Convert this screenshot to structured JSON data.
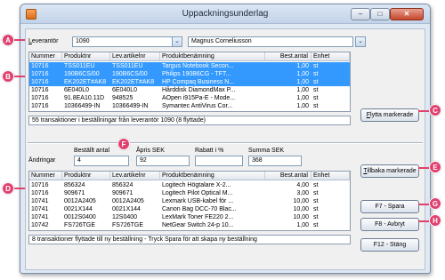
{
  "window": {
    "title": "Uppackningsunderlag",
    "min": "–",
    "max": "□",
    "close": "✕"
  },
  "supplier": {
    "label": "Leverantör",
    "code": "1090",
    "name": "Magnus Corneliusson",
    "dd": "⌄"
  },
  "top_grid": {
    "headers": [
      "Nummer",
      "Produktnr",
      "Lev.artikelnr",
      "Produktbenämning",
      "Best.antal",
      "Enhet"
    ],
    "rows": [
      {
        "nr": "10716",
        "prod": "TSS011EU",
        "lev": "TSS011EU",
        "name": "Targus Notebook Secon...",
        "qty": "1,00",
        "unit": "st",
        "selected": true
      },
      {
        "nr": "10716",
        "prod": "190B6CS/00",
        "lev": "190B6CS/00",
        "name": "Philips 190B6CG - TFT...",
        "qty": "1,00",
        "unit": "st",
        "selected": true
      },
      {
        "nr": "10716",
        "prod": "EK202ET#AK8",
        "lev": "EK202ET#AK8",
        "name": "HP Compaq Business N...",
        "qty": "1,00",
        "unit": "st",
        "selected": true
      },
      {
        "nr": "10716",
        "prod": "6E040L0",
        "lev": "6E040L0",
        "name": "Hårddisk DiamondMax P...",
        "qty": "1,00",
        "unit": "st",
        "selected": false
      },
      {
        "nr": "10716",
        "prod": "91.8EA10.11D",
        "lev": "948525",
        "name": "AOpen i915Pa-E - Mode...",
        "qty": "1,00",
        "unit": "st",
        "selected": false
      },
      {
        "nr": "10716",
        "prod": "10366499-IN",
        "lev": "10366499-IN",
        "name": "Symantec AntiVirus Cor...",
        "qty": "1,00",
        "unit": "st",
        "selected": false
      }
    ],
    "status": "55 transaktioner i beställningar från leverantör 1090 (8 flyttade)"
  },
  "move_btn": {
    "pre": "",
    "u": "F",
    "post": "lytta markerade"
  },
  "edit": {
    "row_label": "Ändringar",
    "qty_label": "Beställt antal",
    "qty": "4",
    "price_label": "Åpris SEK",
    "price": "92",
    "disc_label": "Rabatt i %",
    "disc": "",
    "sum_label": "Summa SEK",
    "sum": "368"
  },
  "back_btn": {
    "u": "T",
    "post": "illbaka markerade"
  },
  "bottom_grid": {
    "headers": [
      "Nummer",
      "Produktnr",
      "Lev.artikelnr",
      "Produktbenämning",
      "Best.antal",
      "Enhet"
    ],
    "rows": [
      {
        "nr": "10716",
        "prod": "856324",
        "lev": "856324",
        "name": "Logitech Högtalare X-2...",
        "qty": "4,00",
        "unit": "st"
      },
      {
        "nr": "10716",
        "prod": "909671",
        "lev": "909671",
        "name": "Logitech Pilot Optical M...",
        "qty": "3,00",
        "unit": "st"
      },
      {
        "nr": "10741",
        "prod": "0012A2405",
        "lev": "0012A2405",
        "name": "Lexmark USB-kabel för ...",
        "qty": "10,00",
        "unit": "st"
      },
      {
        "nr": "10741",
        "prod": "0021X144",
        "lev": "0021X144",
        "name": "Canon Bag DCC-70 Blac...",
        "qty": "10,00",
        "unit": "st"
      },
      {
        "nr": "10741",
        "prod": "0012S0400",
        "lev": "12S0400",
        "name": "LexMark Toner FE220 2...",
        "qty": "10,00",
        "unit": "st"
      },
      {
        "nr": "10742",
        "prod": "FS726TGE",
        "lev": "FS726TGE",
        "name": "NetGear Switch 24-p 10...",
        "qty": "1,00",
        "unit": "st"
      }
    ],
    "status": "8 transaktioner flyttade till ny beställning - Tryck Spara för att skapa ny beställning"
  },
  "buttons": {
    "save": "F7 - Spara",
    "abort": "F8 - Avbryt",
    "close": "F12 - Stäng"
  },
  "callouts": {
    "a": "A",
    "b": "B",
    "c": "C",
    "d": "D",
    "e": "E",
    "f": "F",
    "g": "G",
    "h": "H"
  },
  "colors": {
    "accent": "#e0416f",
    "selection": "#3399ff",
    "window_bg": "#dfe8f3"
  }
}
